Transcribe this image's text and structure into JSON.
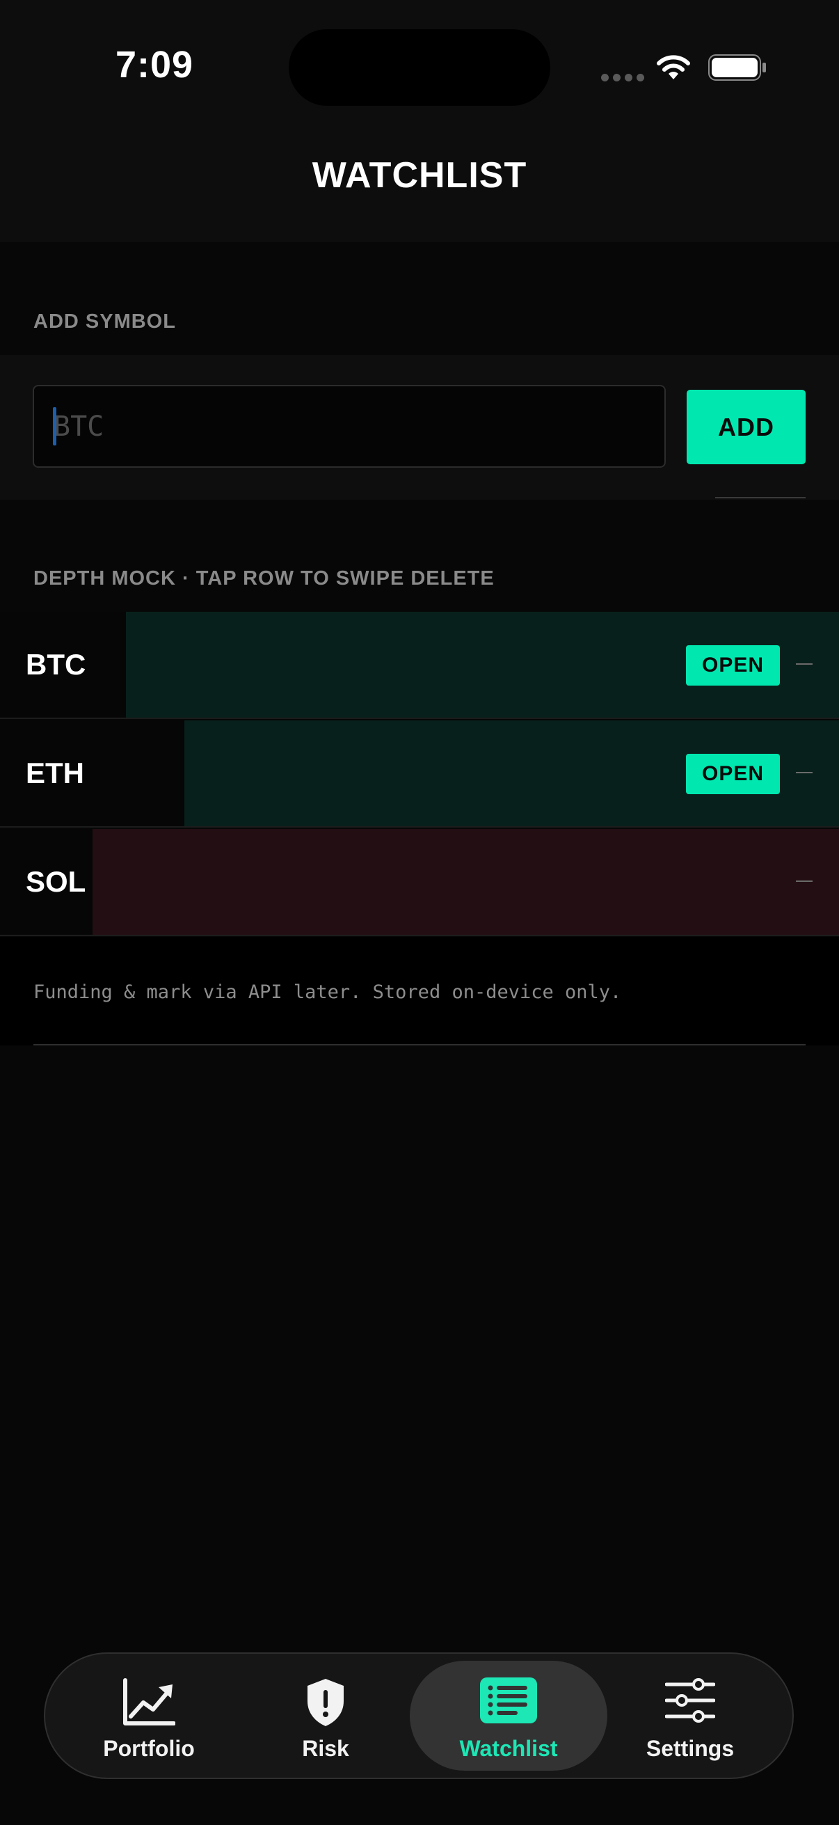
{
  "status_bar": {
    "time": "7:09"
  },
  "header": {
    "title": "WATCHLIST"
  },
  "add_section": {
    "label": "ADD SYMBOL",
    "input_placeholder": "BTC",
    "input_value": "",
    "add_button_label": "ADD"
  },
  "list_section": {
    "label": "DEPTH MOCK · TAP ROW TO SWIPE DELETE",
    "rows": [
      {
        "symbol": "BTC",
        "badge": "OPEN",
        "depth_fraction": 0.85,
        "tone": "green"
      },
      {
        "symbol": "ETH",
        "badge": "OPEN",
        "depth_fraction": 0.78,
        "tone": "green"
      },
      {
        "symbol": "SOL",
        "badge": "",
        "depth_fraction": 0.89,
        "tone": "red"
      }
    ]
  },
  "footer_note": "Funding & mark via API later. Stored on-device only.",
  "tabs": [
    {
      "label": "Portfolio",
      "icon": "chart-line-icon",
      "active": false
    },
    {
      "label": "Risk",
      "icon": "shield-exclamation-icon",
      "active": false
    },
    {
      "label": "Watchlist",
      "icon": "list-icon",
      "active": true
    },
    {
      "label": "Settings",
      "icon": "sliders-icon",
      "active": false
    }
  ],
  "colors": {
    "accent": "#00e8b0",
    "green_depth": "#08201b",
    "red_depth": "#230e13",
    "background": "#070707"
  }
}
